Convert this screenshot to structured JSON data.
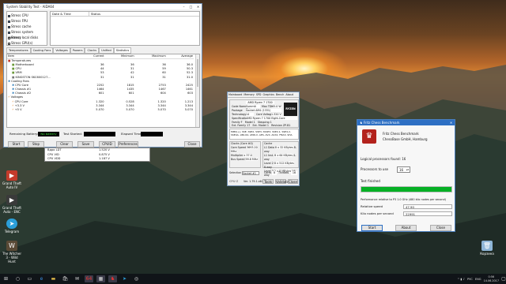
{
  "stress_window": {
    "title": "System Stability Test - AIDA64",
    "checks": [
      {
        "label": "Stress CPU",
        "checked": true
      },
      {
        "label": "Stress FPU",
        "checked": true
      },
      {
        "label": "Stress cache",
        "checked": true
      },
      {
        "label": "Stress system memory",
        "checked": true
      },
      {
        "label": "Stress local disks",
        "checked": false
      },
      {
        "label": "Stress GPU(s)",
        "checked": false
      }
    ],
    "col_date": "Date & Time",
    "col_status": "Status",
    "tabs": [
      "Temperatures",
      "Cooling Fans",
      "Voltages",
      "Powers",
      "Clocks",
      "Unified",
      "Statistics"
    ],
    "stats_headers": [
      "Item",
      "Current",
      "Minimum",
      "Maximum",
      "Average"
    ],
    "rows": [
      {
        "type": "group",
        "item": "Temperatures"
      },
      {
        "item": "Motherboard",
        "cur": "36",
        "min": "36",
        "max": "36",
        "avg": "36.0"
      },
      {
        "item": "CPU",
        "cur": "44",
        "min": "31",
        "max": "59",
        "avg": "50.3"
      },
      {
        "item": "VRM",
        "cur": "53",
        "min": "42",
        "max": "60",
        "avg": "52.3"
      },
      {
        "item": "KINGSTON SKC600127...",
        "cur": "31",
        "min": "31",
        "max": "31",
        "avg": "31.0"
      },
      {
        "type": "group",
        "item": "Cooling Fans"
      },
      {
        "item": "CPU Core",
        "cur": "2252",
        "min": "1815",
        "max": "2753",
        "avg": "2425"
      },
      {
        "item": "Chassis #1",
        "cur": "1464",
        "min": "1435",
        "max": "1467",
        "avg": "1461"
      },
      {
        "item": "Chassis #2",
        "cur": "601",
        "min": "601",
        "max": "604",
        "avg": "603"
      },
      {
        "type": "group",
        "item": "Voltages"
      },
      {
        "item": "CPU Core",
        "cur": "1.320",
        "min": "0.528",
        "max": "1.320",
        "avg": "1.213"
      },
      {
        "item": "+3.3 V",
        "cur": "3.344",
        "min": "3.344",
        "max": "3.344",
        "avg": "3.344"
      },
      {
        "item": "+5 V",
        "cur": "5.070",
        "min": "5.070",
        "max": "5.070",
        "avg": "5.070"
      }
    ],
    "battery_label": "Remaining Battery:",
    "battery_value": "No battery",
    "test_started_label": "Test Started:",
    "elapsed_label": "Elapsed Time:",
    "buttons": [
      "Start",
      "Stop",
      "Clear",
      "Save",
      "CPUID",
      "Preferences",
      "Close"
    ],
    "lower_rows": [
      {
        "item": "Вдро LDT",
        "value": "1.520 V"
      },
      {
        "item": "CPU VID",
        "value": "0.875 V"
      },
      {
        "item": "CPU VDD",
        "value": "1.187 V"
      }
    ]
  },
  "cpuz": {
    "tabs": [
      "Mainboard",
      "Memory",
      "SPD",
      "Graphics",
      "Bench",
      "About"
    ],
    "name": "AMD Ryzen 7 1700",
    "codename": "Summit Ridge",
    "max_tdp": "65.0 W",
    "socket": "Socket AM4 (1331)",
    "technology": "14 nm",
    "core_voltage": "1.320 V",
    "spec": "AMD Ryzen 7 1700 Eight-Core Processor",
    "family": "F",
    "model": "1",
    "stepping": "1",
    "ext_family": "17",
    "ext_model": "1",
    "revision": "ZP-B1",
    "instructions": "MMX(+), SSE, SSE2, SSE3, SSSE3, SSE4.1, SSE4.2, SSE4A, x86-64, AMD-V, AES, AVX, AVX2, FMA3, SHA",
    "clocks_title": "Clocks (Core #0)",
    "cache_title": "Cache",
    "core_speed": "3693.20 MHz",
    "multiplier": "x 37.0",
    "bus_speed": "99.8 MHz",
    "cache_rows": [
      {
        "lvl": "L1 Data",
        "val": "8 x 32 KBytes",
        "way": "8-way"
      },
      {
        "lvl": "L1 Inst.",
        "val": "8 x 64 KBytes",
        "way": "4-way"
      },
      {
        "lvl": "Level 2",
        "val": "8 x 512 KBytes",
        "way": "8-way"
      },
      {
        "lvl": "Level 3",
        "val": "2 x 8 MBytes",
        "way": "16-way"
      }
    ],
    "selection_label": "Selection",
    "selection_value": "Socket #1",
    "cores_label": "Cores",
    "cores_value": "8",
    "threads_label": "Threads",
    "threads_value": "16",
    "version": "Ver. 1.79.1.x64",
    "tools": "Tools",
    "validate": "Validate",
    "close": "Close",
    "logo": "RYZEN"
  },
  "fritz": {
    "title": "Fritz Chess Benchmark",
    "app_name": "Fritz Chess Benchmark",
    "company": "ChessBase GmbH, Hamburg",
    "logical_label": "Logical processors found: 16",
    "procs_label": "Processors to use",
    "procs_value": "16",
    "status": "Test finished",
    "progress": 100,
    "perf_label": "Performance relative to P3 1.0 GHz (480 kilo nodes per second)",
    "relative_label": "Relative speed",
    "relative_value": "47.90",
    "kilo_label": "Kilo nodes per second",
    "kilo_value": "22991",
    "buttons": [
      "Start",
      "About",
      "Close"
    ]
  },
  "desktop_icons": [
    {
      "label": "Grand Theft Auto IV",
      "icon": "gta-icon",
      "color": "#c43b2b"
    },
    {
      "label": "Grand Theft Auto - ENC",
      "icon": "gta-enc-icon",
      "color": "#3a3a3a"
    },
    {
      "label": "Telegram",
      "icon": "telegram-icon",
      "color": "#2b9fd9"
    },
    {
      "label": "The Witcher 3 - Wild Hunt",
      "icon": "witcher-icon",
      "color": "#5a4a36"
    },
    {
      "label": "Корзина",
      "icon": "recycle-bin-icon",
      "color": "#8fb6d8"
    }
  ],
  "taskbar": {
    "apps": [
      "start-icon",
      "search-icon",
      "task-view-icon",
      "edge-icon",
      "explorer-icon",
      "store-icon",
      "mail-icon",
      "aida64-icon",
      "cpuz-icon",
      "fritz-icon",
      "telegram-icon",
      "steam-icon"
    ],
    "tray_lang": "РУС",
    "tray_layout": "ENG",
    "time": "0:56",
    "date": "14.06.2017"
  }
}
